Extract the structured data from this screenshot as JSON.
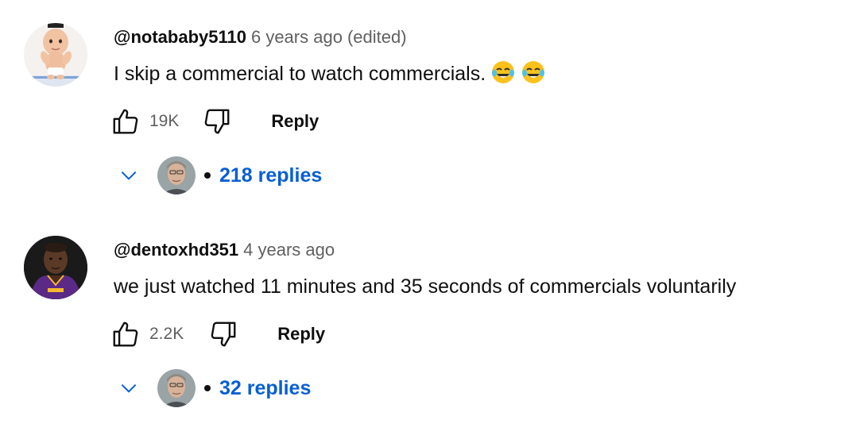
{
  "comments": [
    {
      "author": "@notababy5110",
      "time": "6 years ago",
      "edited": "(edited)",
      "text": "I skip a commercial to watch commercials.",
      "emoji": [
        "face-with-tears-of-joy",
        "face-with-tears-of-joy"
      ],
      "likes": "19K",
      "reply_label": "Reply",
      "replies_label": "218 replies",
      "avatar": "baby-avatar"
    },
    {
      "author": "@dentoxhd351",
      "time": "4 years ago",
      "text": "we just watched 11 minutes and 35 seconds of commercials voluntarily",
      "likes": "2.2K",
      "reply_label": "Reply",
      "replies_label": "32 replies",
      "avatar": "basketball-player-avatar"
    }
  ],
  "colors": {
    "text": "#0f0f0f",
    "secondary_text": "#606060",
    "link_blue": "#065fd4",
    "background": "#ffffff"
  }
}
